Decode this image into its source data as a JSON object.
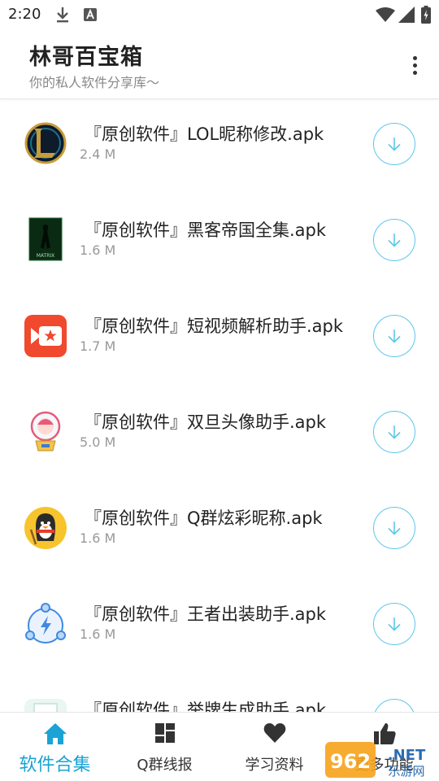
{
  "status_bar": {
    "time": "2:20",
    "icons": [
      "download-icon",
      "a-icon",
      "wifi-icon",
      "signal-icon",
      "battery-icon"
    ]
  },
  "header": {
    "title": "林哥百宝箱",
    "subtitle": "你的私人软件分享库～",
    "menu_icon": "more-vert-icon"
  },
  "colors": {
    "accent": "#1aa3d4",
    "download_ring": "#5bc8e8",
    "text_primary": "#222222",
    "text_secondary": "#999999"
  },
  "list": [
    {
      "name": "『原创软件』LOL昵称修改.apk",
      "size": "2.4 M",
      "icon": "lol-logo-icon"
    },
    {
      "name": "『原创软件』黑客帝国全集.apk",
      "size": "1.6 M",
      "icon": "matrix-poster-icon"
    },
    {
      "name": "『原创软件』短视频解析助手.apk",
      "size": "1.7 M",
      "icon": "video-star-icon"
    },
    {
      "name": "『原创软件』双旦头像助手.apk",
      "size": "5.0 M",
      "icon": "snow-globe-icon"
    },
    {
      "name": "『原创软件』Q群炫彩昵称.apk",
      "size": "1.6 M",
      "icon": "qq-penguin-icon"
    },
    {
      "name": "『原创软件』王者出装助手.apk",
      "size": "1.6 M",
      "icon": "lightning-network-icon"
    },
    {
      "name": "『原创软件』举牌生成助手.apk",
      "size": "",
      "icon": "sign-board-icon"
    }
  ],
  "bottom_nav": [
    {
      "label": "软件合集",
      "icon": "home-icon",
      "active": true
    },
    {
      "label": "Q群线报",
      "icon": "dashboard-icon",
      "active": false
    },
    {
      "label": "学习资料",
      "icon": "heart-icon",
      "active": false
    },
    {
      "label": "更多功能",
      "icon": "thumbs-up-icon",
      "active": false
    }
  ],
  "watermark": {
    "text_top": "962.NET",
    "text_bottom": "乐游网"
  }
}
